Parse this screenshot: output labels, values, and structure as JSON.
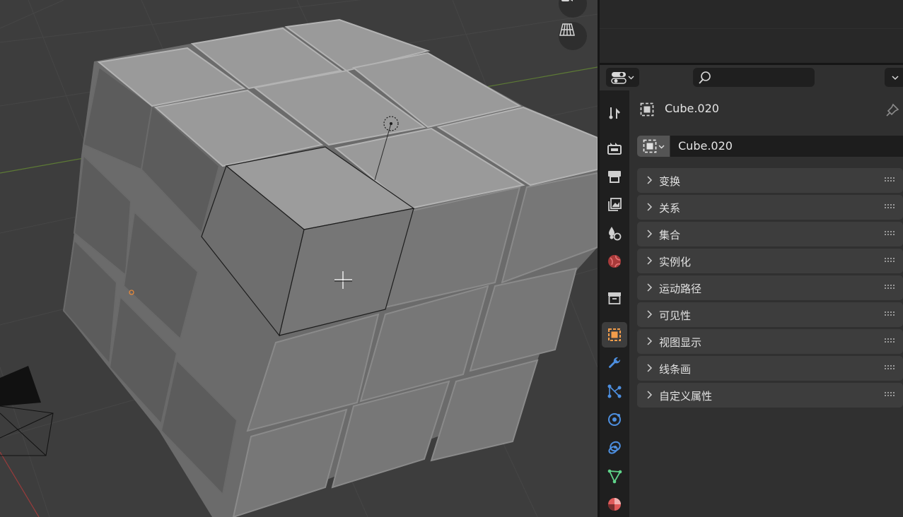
{
  "viewport": {
    "nav_icons": [
      "camera-view-icon",
      "perspective-grid-icon"
    ]
  },
  "properties_header": {
    "editor_type_icon": "properties-editor-icon",
    "search_placeholder": ""
  },
  "tabs": [
    {
      "name": "tool",
      "color": "#cfcfcf"
    },
    {
      "name": "render",
      "color": "#cfcfcf"
    },
    {
      "name": "output",
      "color": "#cfcfcf"
    },
    {
      "name": "view-layer",
      "color": "#cfcfcf"
    },
    {
      "name": "scene",
      "color": "#cfcfcf"
    },
    {
      "name": "world",
      "color": "#e05555"
    },
    {
      "name": "collection",
      "color": "#cfcfcf"
    },
    {
      "name": "object",
      "color": "#f29d4b",
      "active": true
    },
    {
      "name": "modifiers",
      "color": "#4d8fe0"
    },
    {
      "name": "particles",
      "color": "#4d8fe0"
    },
    {
      "name": "physics",
      "color": "#4d8fe0"
    },
    {
      "name": "constraints",
      "color": "#4d8fe0"
    },
    {
      "name": "data",
      "color": "#5fd48a"
    },
    {
      "name": "material",
      "color": "#e05a5a"
    }
  ],
  "object": {
    "header_name": "Cube.020",
    "name_field": "Cube.020"
  },
  "panels": [
    {
      "label": "变换"
    },
    {
      "label": "关系"
    },
    {
      "label": "集合"
    },
    {
      "label": "实例化"
    },
    {
      "label": "运动路径"
    },
    {
      "label": "可见性"
    },
    {
      "label": "视图显示"
    },
    {
      "label": "线条画"
    },
    {
      "label": "自定义属性"
    }
  ]
}
